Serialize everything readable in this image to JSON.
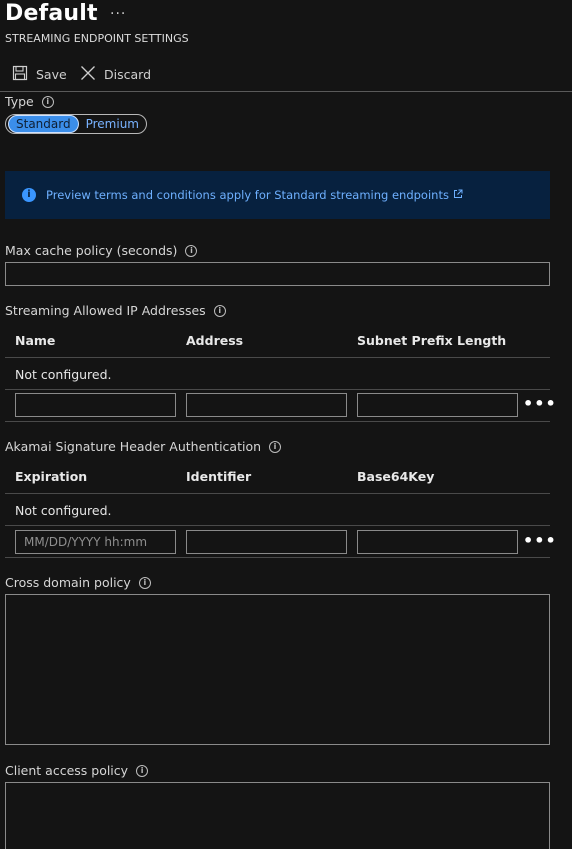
{
  "header": {
    "title": "Default",
    "more_label": "···",
    "subtitle": "STREAMING ENDPOINT SETTINGS"
  },
  "toolbar": {
    "save_label": "Save",
    "discard_label": "Discard"
  },
  "type": {
    "label": "Type",
    "options": [
      "Standard",
      "Premium"
    ],
    "selected": "Standard"
  },
  "banner": {
    "icon_glyph": "i",
    "link_text": "Preview terms and conditions apply for Standard streaming endpoints"
  },
  "max_cache": {
    "label": "Max cache policy (seconds)",
    "value": ""
  },
  "ip_section": {
    "label": "Streaming Allowed IP Addresses",
    "columns": [
      "Name",
      "Address",
      "Subnet Prefix Length"
    ],
    "empty_text": "Not configured.",
    "row_placeholders": [
      "",
      "",
      ""
    ],
    "more_label": "•••"
  },
  "akamai_section": {
    "label": "Akamai Signature Header Authentication",
    "columns": [
      "Expiration",
      "Identifier",
      "Base64Key"
    ],
    "empty_text": "Not configured.",
    "row_placeholders": [
      "MM/DD/YYYY hh:mm",
      "",
      ""
    ],
    "more_label": "•••"
  },
  "cross_domain": {
    "label": "Cross domain policy",
    "value": ""
  },
  "client_access": {
    "label": "Client access policy",
    "value": ""
  },
  "colors": {
    "background": "#141414",
    "accent": "#3b8eea",
    "link": "#6eb0ff",
    "banner_bg": "#07213f"
  }
}
